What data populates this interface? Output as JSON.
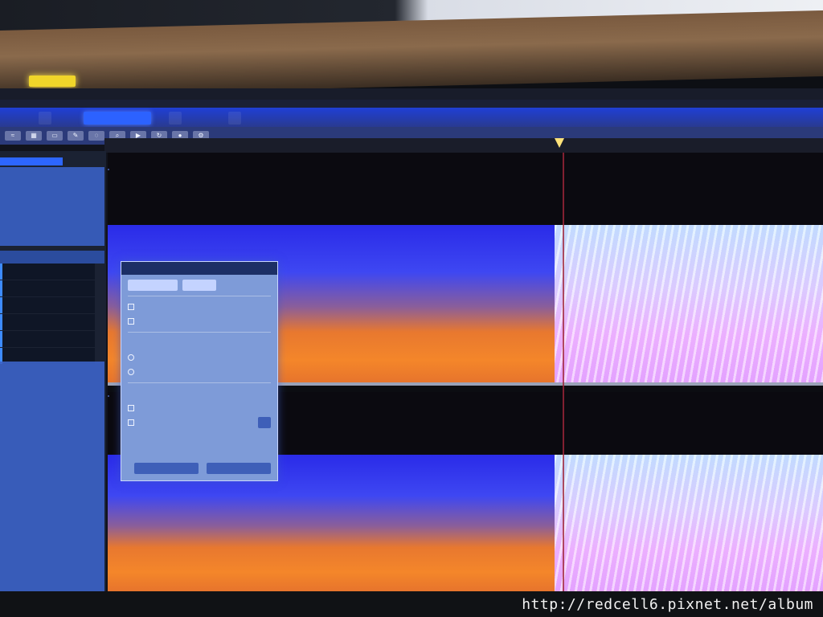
{
  "window": {
    "path": ""
  },
  "menu": {
    "items": [
      "",
      "",
      "",
      "",
      ""
    ]
  },
  "toolbar": {
    "buttons": [
      "",
      "",
      "",
      ""
    ]
  },
  "tools": {
    "icons": [
      "waveform-icon",
      "spectral-icon",
      "select-icon",
      "brush-icon",
      "lasso-icon",
      "zoom-icon",
      "play-icon",
      "loop-icon",
      "record-icon",
      "settings-icon"
    ]
  },
  "ruler": {
    "ticks": [
      "",
      "",
      "",
      "",
      "",
      "",
      "",
      "",
      "",
      "",
      "",
      "",
      "",
      "",
      "",
      "",
      ""
    ]
  },
  "left_panel": {
    "section": "",
    "items": [
      "",
      "",
      "",
      "",
      "",
      ""
    ]
  },
  "tracks": {
    "ch1_label": "",
    "ch2_label": ""
  },
  "dialog": {
    "title": "",
    "close": "",
    "select_value": "",
    "select_value_2": "",
    "option_1": "",
    "option_2": "",
    "group_label": "",
    "radio_1": "",
    "radio_2": "",
    "section_label": "",
    "checkbox_1": "",
    "checkbox_2": "",
    "apply": "",
    "ok": "",
    "cancel": ""
  },
  "watermark": "http://redcell6.pixnet.net/album",
  "colors": {
    "accent": "#2c62ff",
    "toolbar": "#1f3fd6",
    "spectrum_low": "#e8782f",
    "spectrum_high": "#2a2be8",
    "spectrum_right": "#dcd0ff",
    "playhead": "#a0263a"
  }
}
